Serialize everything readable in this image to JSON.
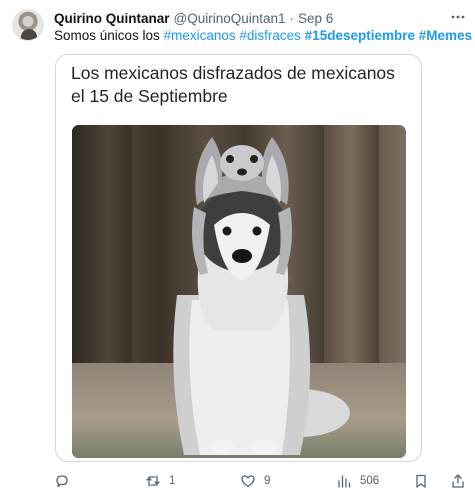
{
  "tweet": {
    "author_name": "Quirino Quintanar",
    "author_handle": "@QuirinoQuintan1",
    "separator": "·",
    "time": "Sep 6",
    "text_prefix": "Somos únicos los ",
    "tags": [
      {
        "text": "#mexicanos",
        "bold": false
      },
      {
        "text": "#disfraces",
        "bold": false
      },
      {
        "text": "#15deseptiembre",
        "bold": true
      },
      {
        "text": "#Memes",
        "bold": true
      }
    ]
  },
  "card": {
    "caption": "Los mexicanos disfrazados de mexicanos el 15 de Septiembre",
    "image_subject": "husky-wearing-wolf-hat"
  },
  "actions": {
    "reply_count": "",
    "retweet_count": "1",
    "like_count": "9",
    "views_count": "506"
  },
  "colors": {
    "link": "#1d9bf0",
    "muted": "#536471",
    "text": "#0f1419",
    "border": "#cfd9de"
  }
}
